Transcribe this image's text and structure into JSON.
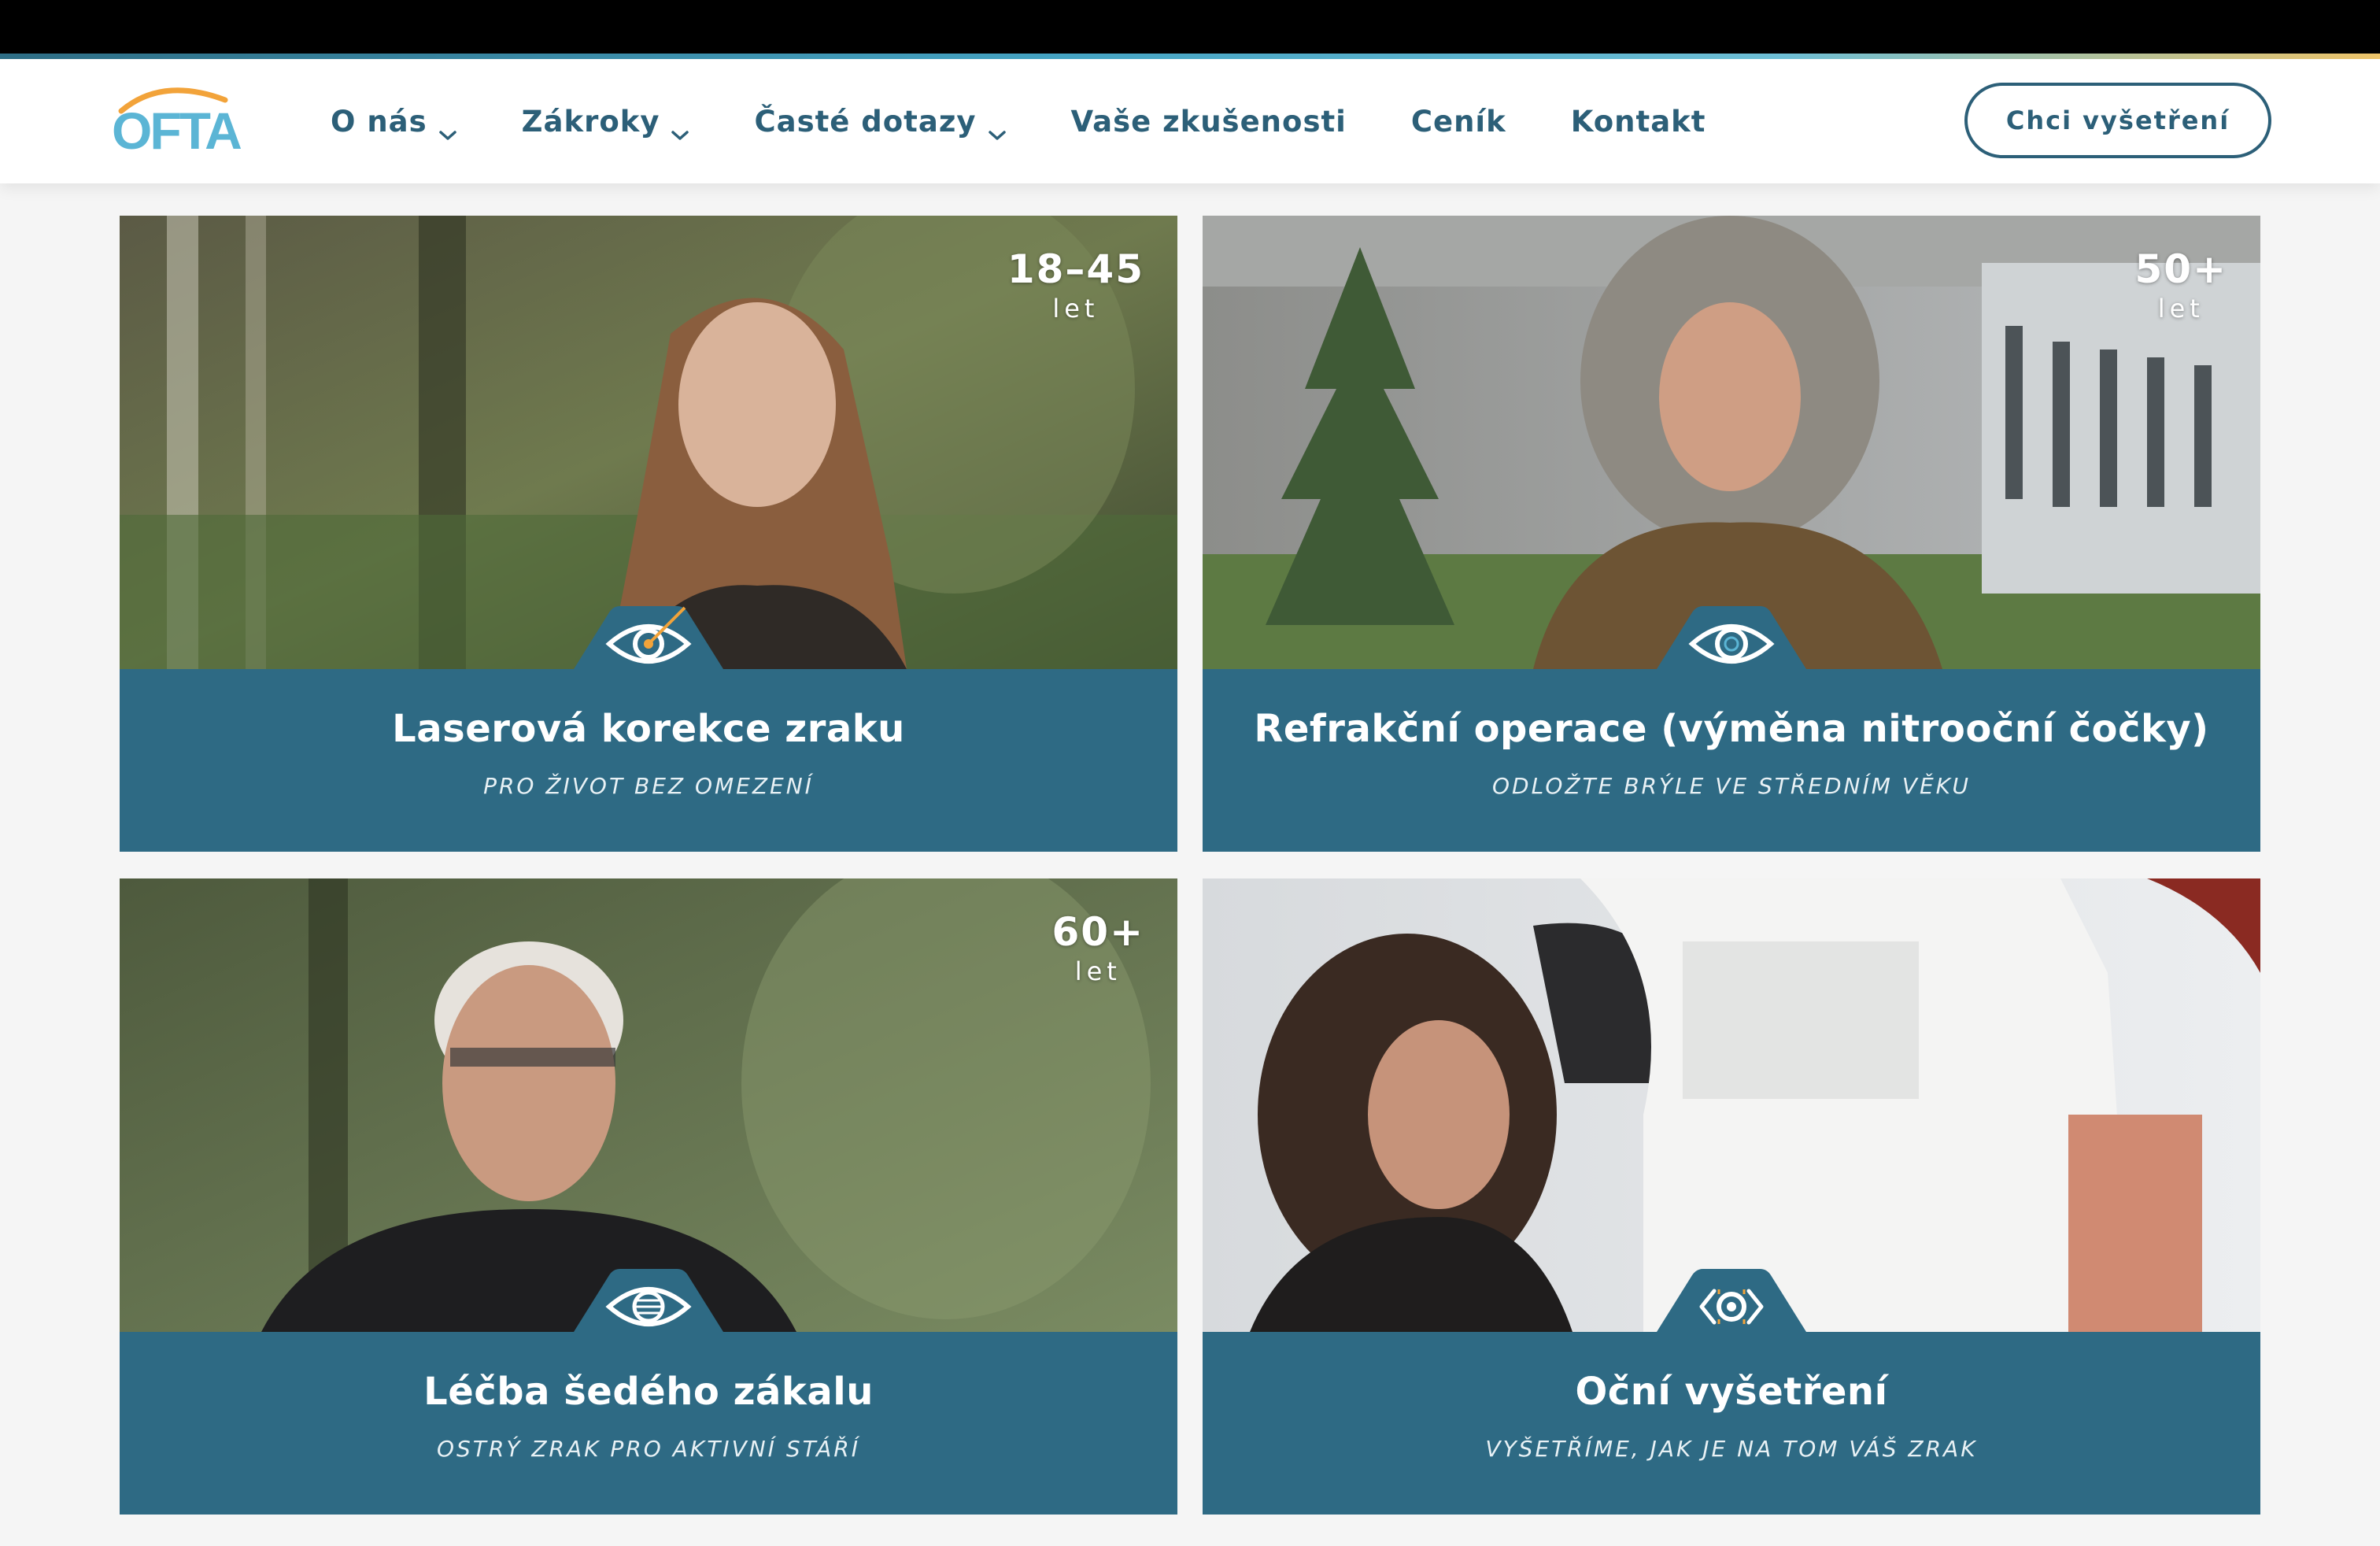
{
  "nav": {
    "logo_text": "OFTA",
    "items": [
      {
        "label": "O nás",
        "dropdown": true
      },
      {
        "label": "Zákroky",
        "dropdown": true
      },
      {
        "label": "Časté dotazy",
        "dropdown": true
      },
      {
        "label": "Vaše zkušenosti",
        "dropdown": false
      },
      {
        "label": "Ceník",
        "dropdown": false
      },
      {
        "label": "Kontakt",
        "dropdown": false
      }
    ],
    "cta_label": "Chci vyšetření"
  },
  "cards": [
    {
      "title": "Laserová korekce zraku",
      "subtitle": "PRO ŽIVOT BEZ OMEZENÍ",
      "age": "18–45",
      "age_unit": "let",
      "icon": "eye-laser-icon"
    },
    {
      "title": "Refrakční operace (výměna nitrooční čočky)",
      "subtitle": "ODLOŽTE BRÝLE VE STŘEDNÍM VĚKU",
      "age": "50+",
      "age_unit": "let",
      "icon": "eye-lens-icon"
    },
    {
      "title": "Léčba šedého zákalu",
      "subtitle": "OSTRÝ ZRAK PRO AKTIVNÍ STÁŘÍ",
      "age": "60+",
      "age_unit": "let",
      "icon": "eye-cataract-icon"
    },
    {
      "title": "Oční vyšetření",
      "subtitle": "VYŠETŘÍME, JAK JE NA TOM VÁŠ ZRAK",
      "icon": "eye-exam-icon"
    }
  ],
  "colors": {
    "brand": "#2c5f78",
    "panel": "#2e6a84",
    "accent_orange": "#f2a33a",
    "accent_light_blue": "#5bb5d5"
  }
}
